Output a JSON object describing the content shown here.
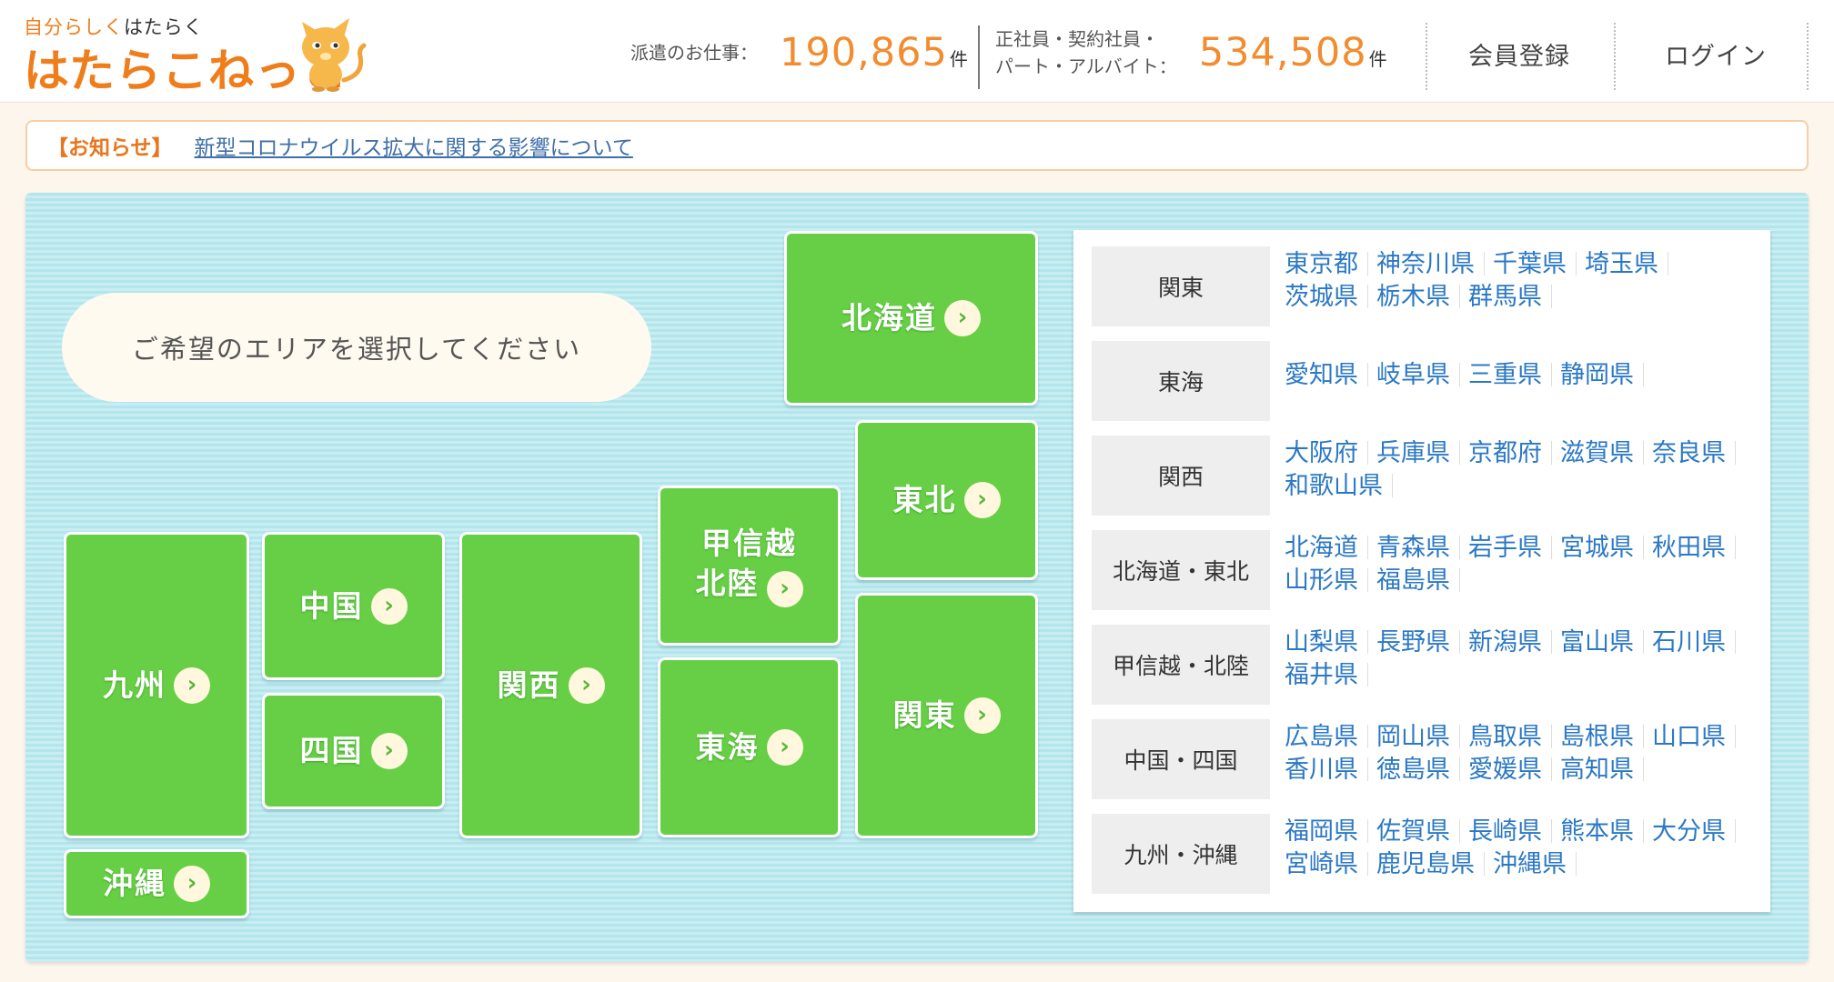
{
  "header": {
    "tagline_part1": "自分らしく",
    "tagline_part2": "はたらく",
    "brand": "はたらこねっと",
    "stats": [
      {
        "label": "派遣のお仕事：",
        "value": "190,865",
        "unit": "件"
      },
      {
        "label_line1": "正社員・契約社員・",
        "label_line2": "パート・アルバイト：",
        "value": "534,508",
        "unit": "件"
      }
    ],
    "nav": {
      "register": "会員登録",
      "login": "ログイン"
    }
  },
  "notice": {
    "label": "【お知らせ】",
    "link": "新型コロナウイルス拡大に関する影響について"
  },
  "map": {
    "prompt": "ご希望のエリアを選択してください",
    "regions": {
      "hokkaido": "北海道",
      "tohoku": "東北",
      "koshinetsu_line1": "甲信越",
      "koshinetsu_line2": "北陸",
      "kanto": "関東",
      "tokai": "東海",
      "kansai": "関西",
      "chugoku": "中国",
      "shikoku": "四国",
      "kyushu": "九州",
      "okinawa": "沖縄"
    },
    "arrow": "›"
  },
  "area_list": [
    {
      "area": "関東",
      "prefs": [
        "東京都",
        "神奈川県",
        "千葉県",
        "埼玉県",
        "茨城県",
        "栃木県",
        "群馬県"
      ]
    },
    {
      "area": "東海",
      "prefs": [
        "愛知県",
        "岐阜県",
        "三重県",
        "静岡県"
      ]
    },
    {
      "area": "関西",
      "prefs": [
        "大阪府",
        "兵庫県",
        "京都府",
        "滋賀県",
        "奈良県",
        "和歌山県"
      ]
    },
    {
      "area": "北海道・東北",
      "prefs": [
        "北海道",
        "青森県",
        "岩手県",
        "宮城県",
        "秋田県",
        "山形県",
        "福島県"
      ]
    },
    {
      "area": "甲信越・北陸",
      "prefs": [
        "山梨県",
        "長野県",
        "新潟県",
        "富山県",
        "石川県",
        "福井県"
      ]
    },
    {
      "area": "中国・四国",
      "prefs": [
        "広島県",
        "岡山県",
        "鳥取県",
        "島根県",
        "山口県",
        "香川県",
        "徳島県",
        "愛媛県",
        "高知県"
      ]
    },
    {
      "area": "九州・沖縄",
      "prefs": [
        "福岡県",
        "佐賀県",
        "長崎県",
        "熊本県",
        "大分県",
        "宮崎県",
        "鹿児島県",
        "沖縄県"
      ]
    }
  ],
  "colors": {
    "accent": "#f07d1b",
    "map_green": "#67cf45",
    "link_blue": "#2b78c4"
  }
}
